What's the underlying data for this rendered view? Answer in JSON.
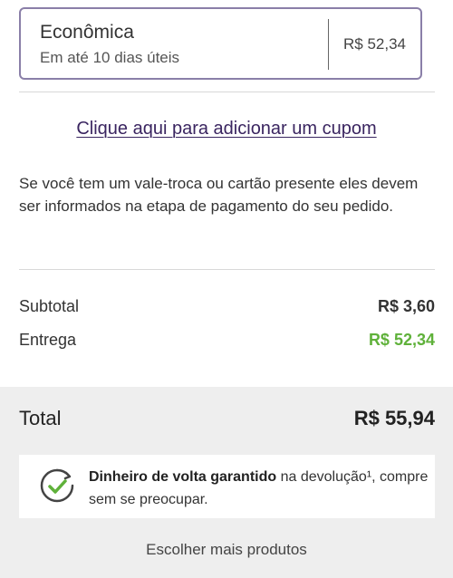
{
  "shipping": {
    "name": "Econômica",
    "eta": "Em até 10 dias úteis",
    "price": "R$ 52,34"
  },
  "coupon": {
    "link_label": "Clique aqui para adicionar um cupom"
  },
  "gift_note": "Se você tem um vale-troca ou cartão presente eles devem ser informados na etapa de pagamento do seu pedido.",
  "summary": {
    "subtotal_label": "Subtotal",
    "subtotal_value": "R$ 3,60",
    "delivery_label": "Entrega",
    "delivery_value": "R$ 52,34",
    "total_label": "Total",
    "total_value": "R$ 55,94"
  },
  "guarantee": {
    "icon": "refresh-check-icon",
    "bold_text": "Dinheiro de volta garantido",
    "rest_text": " na devolução¹, compre sem se preocupar."
  },
  "more_products_label": "Escolher mais produtos",
  "colors": {
    "card_border": "#8a7fa8",
    "link": "#3a2560",
    "delivery_value": "#5fb13a",
    "footer_bg": "#eeeeee"
  }
}
